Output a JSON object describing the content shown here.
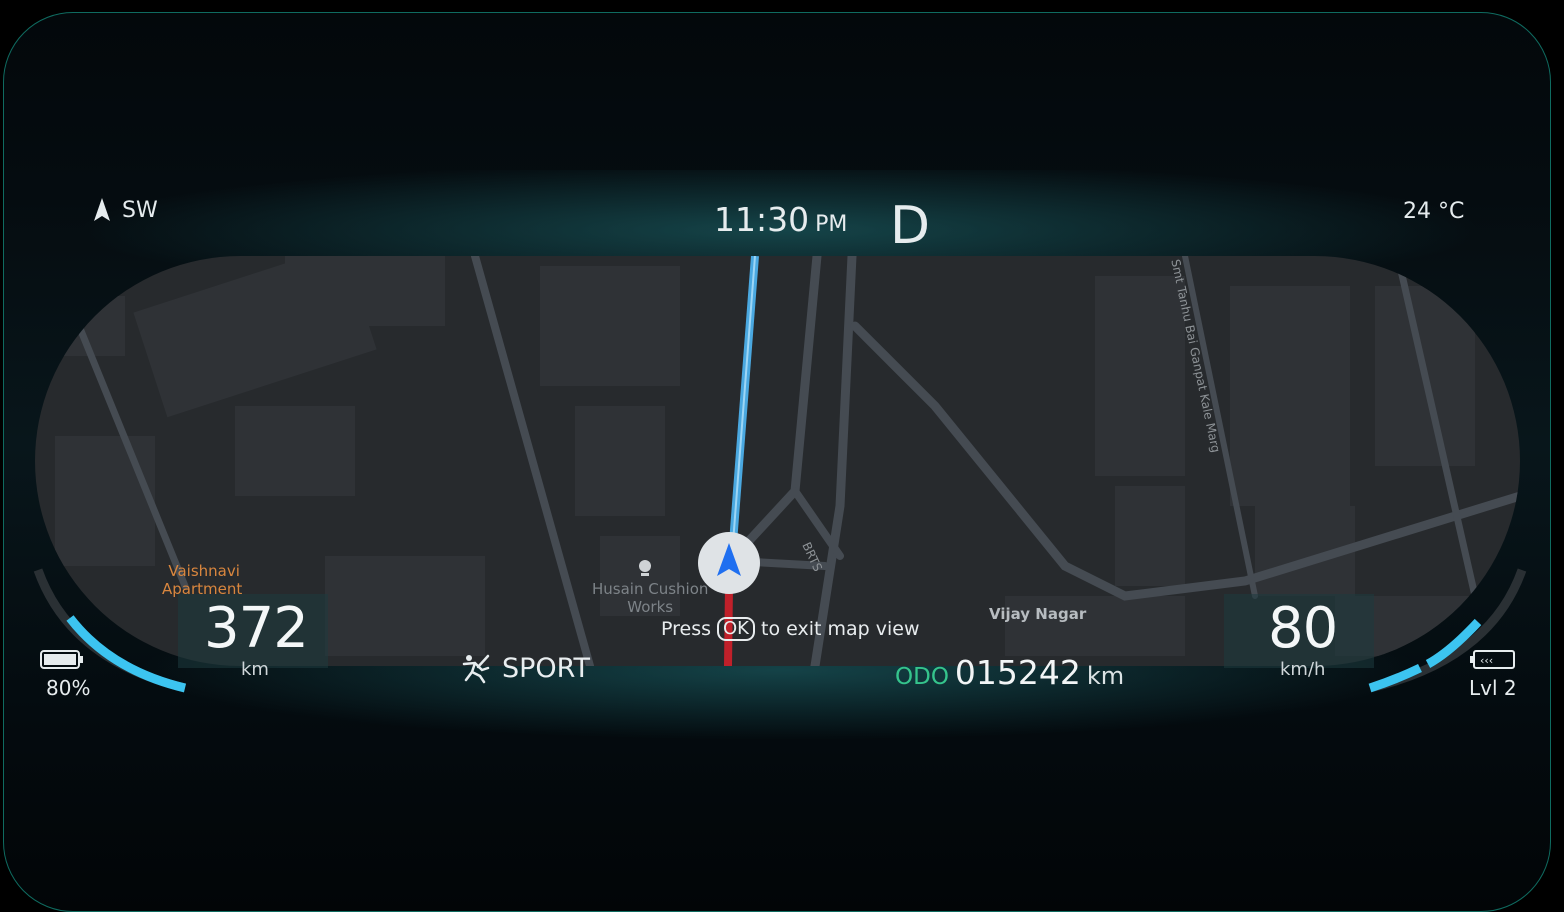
{
  "header": {
    "compass_direction": "SW",
    "time": "11:30",
    "time_period": "PM",
    "gear": "D",
    "temperature": "24 °C"
  },
  "range": {
    "value": "372",
    "unit": "km"
  },
  "speed": {
    "value": "80",
    "unit": "km/h"
  },
  "battery": {
    "percent_label": "80%",
    "level": 0.8
  },
  "regen": {
    "label": "Lvl 2",
    "level": 2
  },
  "drive_mode": {
    "label": "SPORT"
  },
  "odometer": {
    "label": "ODO",
    "value": "015242",
    "unit": "km"
  },
  "hint": {
    "prefix": "Press",
    "key": "OK",
    "suffix": "to exit map view"
  },
  "map": {
    "labels": {
      "apartment_line1": "Vaishnavi",
      "apartment_line2": "Apartment",
      "poi_line1": "Husain Cushion",
      "poi_line2": "Works",
      "area": "Vijay Nagar",
      "road_brts": "BRTS",
      "road_marg": "Smt Tanhu Bai Ganpat Kale Marg"
    }
  },
  "colors": {
    "accent": "#3cc4f0",
    "odo_label": "#35c48c",
    "route": "#4aa8e0",
    "route_behind": "#c0202a",
    "map_bg": "#272a2d",
    "frame_border": "#0f6b60"
  },
  "icons": {
    "compass": "navigation-arrow-icon",
    "drive_mode": "sport-runner-icon",
    "battery": "battery-icon",
    "regen": "regen-chevrons-icon",
    "vehicle": "vehicle-position-icon",
    "poi": "place-pin-icon"
  }
}
